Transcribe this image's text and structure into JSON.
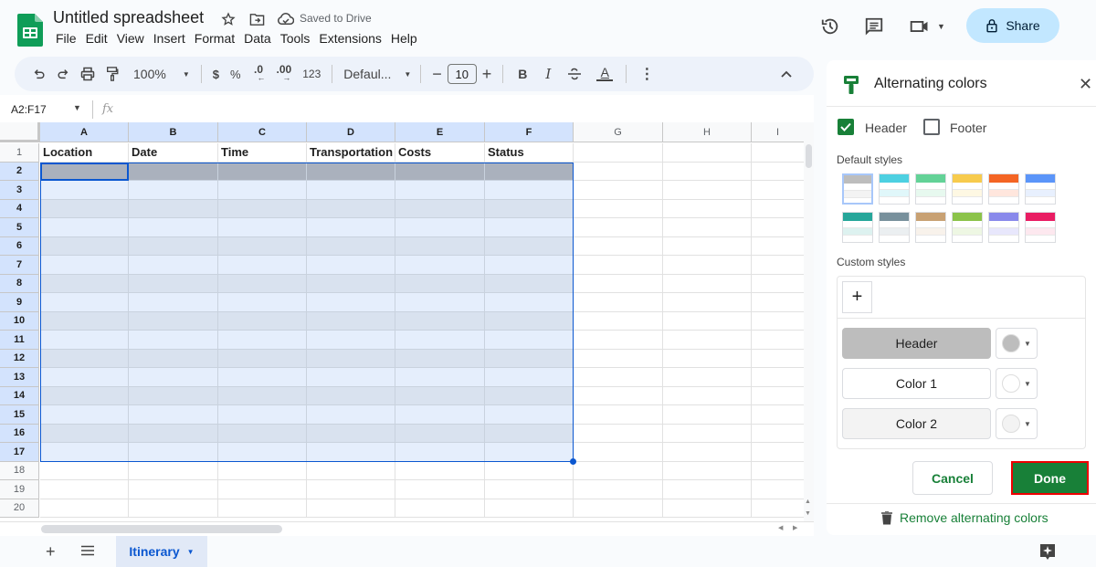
{
  "app": {
    "title": "Untitled spreadsheet",
    "saved_status": "Saved to Drive",
    "menu": [
      "File",
      "Edit",
      "View",
      "Insert",
      "Format",
      "Data",
      "Tools",
      "Extensions",
      "Help"
    ],
    "share_label": "Share"
  },
  "toolbar": {
    "zoom": "100%",
    "currency": "$",
    "percent": "%",
    "decrease_decimal": ".0",
    "increase_decimal": ".00",
    "number_format": "123",
    "font": "Defaul...",
    "font_size": "10",
    "bold": "B",
    "italic": "I",
    "text_color": "A"
  },
  "formula_bar": {
    "name_box": "A2:F17",
    "fx": "fx",
    "value": ""
  },
  "grid": {
    "columns": [
      "A",
      "B",
      "C",
      "D",
      "E",
      "F",
      "G",
      "H",
      "I"
    ],
    "selected_columns": [
      "A",
      "B",
      "C",
      "D",
      "E",
      "F"
    ],
    "rows": [
      "1",
      "2",
      "3",
      "4",
      "5",
      "6",
      "7",
      "8",
      "9",
      "10",
      "11",
      "12",
      "13",
      "14",
      "15",
      "16",
      "17",
      "18",
      "19",
      "20"
    ],
    "header_row": [
      "Location",
      "Date",
      "Time",
      "Transportation",
      "Costs",
      "Status"
    ],
    "selection": "A2:F17",
    "colors": {
      "header_band": "#aab1bd",
      "color1": "#e5eefc",
      "color2": "#d9e2ef",
      "selection_border": "#0b57d0"
    }
  },
  "sheets": {
    "add": "+",
    "active_tab": "Itinerary"
  },
  "panel": {
    "title": "Alternating colors",
    "header_checkbox": {
      "label": "Header",
      "checked": true
    },
    "footer_checkbox": {
      "label": "Footer",
      "checked": false
    },
    "default_styles_label": "Default styles",
    "default_styles": [
      {
        "header": "#bdbdbd",
        "alt": "#f3f3f3"
      },
      {
        "header": "#4dd0e1",
        "alt": "#e0f7fa"
      },
      {
        "header": "#63d297",
        "alt": "#e7f9ef"
      },
      {
        "header": "#f7cb4d",
        "alt": "#fef8e3"
      },
      {
        "header": "#f46524",
        "alt": "#ffe6dd"
      },
      {
        "header": "#5b95f9",
        "alt": "#e8f0fe"
      },
      {
        "header": "#26a69a",
        "alt": "#ddf2f0"
      },
      {
        "header": "#78909c",
        "alt": "#ebeff1"
      },
      {
        "header": "#c8a173",
        "alt": "#f8f2eb"
      },
      {
        "header": "#8bc34a",
        "alt": "#eef7e3"
      },
      {
        "header": "#8989eb",
        "alt": "#e8e7fc"
      },
      {
        "header": "#e91d63",
        "alt": "#fde8ef"
      }
    ],
    "custom_styles_label": "Custom styles",
    "add_custom": "+",
    "custom": [
      {
        "label": "Header",
        "bg": "#bdbdbd",
        "dot": "#bdbdbd"
      },
      {
        "label": "Color 1",
        "bg": "#ffffff",
        "dot": "#ffffff"
      },
      {
        "label": "Color 2",
        "bg": "#f3f3f3",
        "dot": "#f3f3f3"
      }
    ],
    "cancel_label": "Cancel",
    "done_label": "Done",
    "remove_label": "Remove alternating colors"
  }
}
